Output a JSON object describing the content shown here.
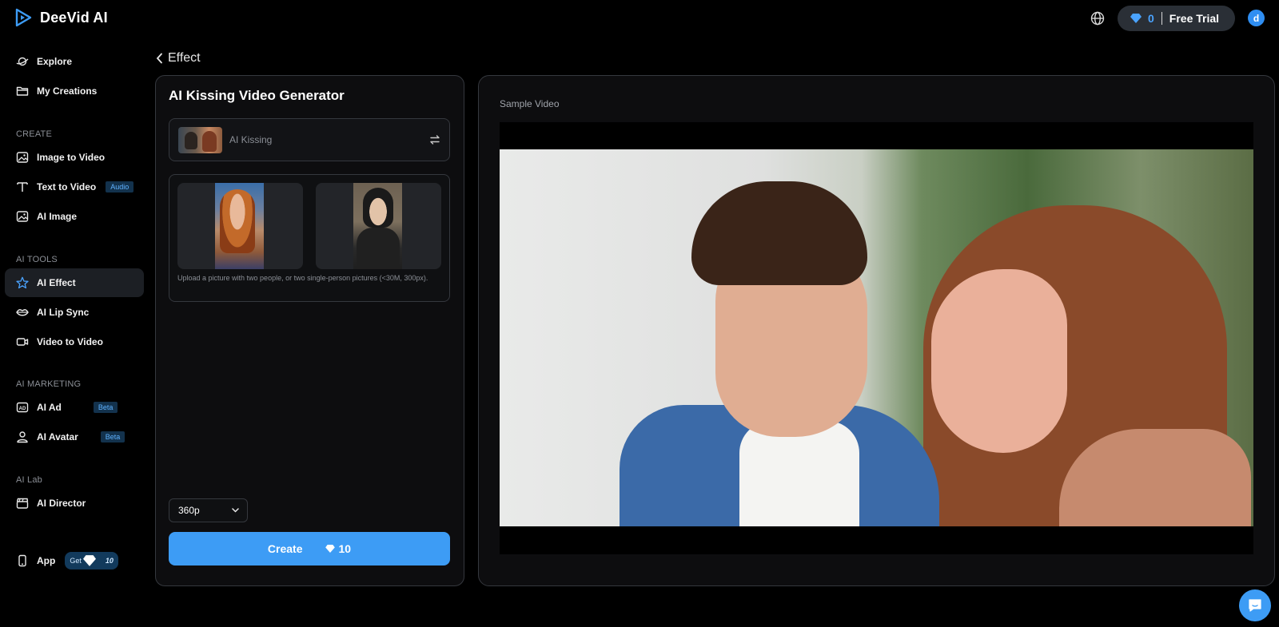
{
  "brand": {
    "name": "DeeVid AI"
  },
  "header": {
    "credits": "0",
    "free_trial_label": "Free Trial",
    "avatar_letter": "d"
  },
  "sidebar": {
    "explore": "Explore",
    "my_creations": "My Creations",
    "section_create": "CREATE",
    "image_to_video": "Image to Video",
    "text_to_video": "Text to Video",
    "text_to_video_badge": "Audio",
    "ai_image": "AI Image",
    "section_tools": "AI TOOLS",
    "ai_effect": "AI Effect",
    "ai_lip_sync": "AI Lip Sync",
    "video_to_video": "Video to Video",
    "section_marketing": "AI MARKETING",
    "ai_ad": "AI Ad",
    "ai_ad_badge": "Beta",
    "ai_avatar": "AI Avatar",
    "ai_avatar_badge": "Beta",
    "section_lab": "AI Lab",
    "ai_director": "AI Director",
    "app": "App",
    "app_badge_prefix": "Get",
    "app_badge_value": "10",
    "active_item": "AI Effect"
  },
  "breadcrumb": {
    "back_label": "Effect"
  },
  "generator": {
    "title": "AI Kissing Video Generator",
    "effect_name": "AI Kissing",
    "upload_hint": "Upload a picture with two people, or two single-person pictures (<30M, 300px).",
    "resolution": "360p",
    "create_label": "Create",
    "create_cost": "10"
  },
  "preview": {
    "label": "Sample Video"
  },
  "colors": {
    "accent": "#3d9cf5",
    "background": "#000000",
    "panel": "#0d0d0f",
    "border": "#35383e"
  }
}
